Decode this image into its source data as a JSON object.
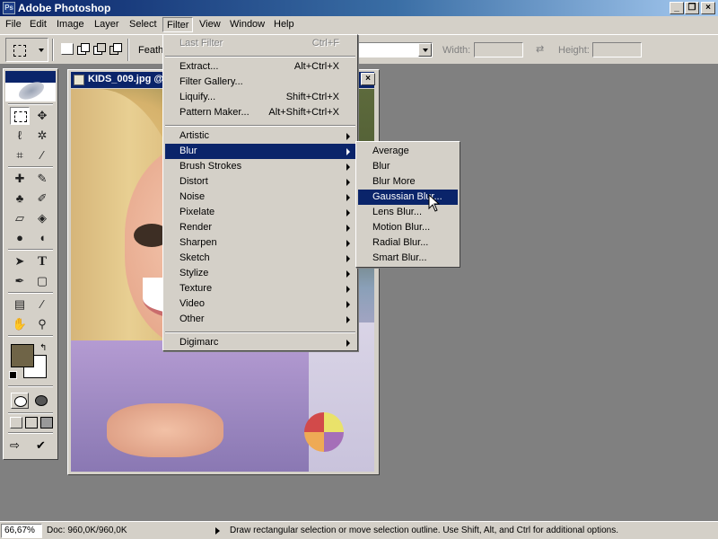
{
  "app": {
    "title": "Adobe Photoshop",
    "logo_icon": "photoshop-logo-icon",
    "window_controls": [
      "minimize-icon",
      "restore-icon",
      "close-icon"
    ]
  },
  "menubar": {
    "items": [
      "File",
      "Edit",
      "Image",
      "Layer",
      "Select",
      "Filter",
      "View",
      "Window",
      "Help"
    ],
    "active": "Filter"
  },
  "options_bar": {
    "feather_label": "Feath",
    "width_label": "Width:",
    "height_label": "Height:",
    "swap_icon": "swap-arrows-icon"
  },
  "document": {
    "title": "KIDS_009.jpg @"
  },
  "filter_menu": {
    "items": [
      {
        "label": "Last Filter",
        "shortcut": "Ctrl+F",
        "disabled": true
      },
      {
        "separator": true
      },
      {
        "label": "Extract...",
        "shortcut": "Alt+Ctrl+X"
      },
      {
        "label": "Filter Gallery..."
      },
      {
        "label": "Liquify...",
        "shortcut": "Shift+Ctrl+X"
      },
      {
        "label": "Pattern Maker...",
        "shortcut": "Alt+Shift+Ctrl+X"
      },
      {
        "separator": true
      },
      {
        "label": "Artistic",
        "submenu": true
      },
      {
        "label": "Blur",
        "submenu": true,
        "highlighted": true
      },
      {
        "label": "Brush Strokes",
        "submenu": true
      },
      {
        "label": "Distort",
        "submenu": true
      },
      {
        "label": "Noise",
        "submenu": true
      },
      {
        "label": "Pixelate",
        "submenu": true
      },
      {
        "label": "Render",
        "submenu": true
      },
      {
        "label": "Sharpen",
        "submenu": true
      },
      {
        "label": "Sketch",
        "submenu": true
      },
      {
        "label": "Stylize",
        "submenu": true
      },
      {
        "label": "Texture",
        "submenu": true
      },
      {
        "label": "Video",
        "submenu": true
      },
      {
        "label": "Other",
        "submenu": true
      },
      {
        "separator": true
      },
      {
        "label": "Digimarc",
        "submenu": true
      }
    ]
  },
  "blur_submenu": {
    "items": [
      {
        "label": "Average"
      },
      {
        "label": "Blur"
      },
      {
        "label": "Blur More"
      },
      {
        "label": "Gaussian Blur...",
        "highlighted": true
      },
      {
        "label": "Lens Blur..."
      },
      {
        "label": "Motion Blur..."
      },
      {
        "label": "Radial Blur..."
      },
      {
        "label": "Smart Blur..."
      }
    ]
  },
  "toolbox": {
    "tools": [
      "marquee-icon",
      "move-icon",
      "lasso-icon",
      "magic-wand-icon",
      "crop-icon",
      "slice-icon",
      "healing-brush-icon",
      "brush-icon",
      "clone-stamp-icon",
      "history-brush-icon",
      "eraser-icon",
      "paint-bucket-icon",
      "blur-tool-icon",
      "dodge-icon",
      "path-selection-icon",
      "type-icon",
      "pen-icon",
      "rectangle-icon",
      "notes-icon",
      "eyedropper-icon",
      "hand-icon",
      "zoom-icon"
    ],
    "foreground_color": "#6f6447",
    "background_color": "#ffffff"
  },
  "statusbar": {
    "zoom": "66,67%",
    "doc_info": "Doc: 960,0K/960,0K",
    "message": "Draw rectangular selection or move selection outline.  Use Shift, Alt, and Ctrl for additional options."
  }
}
